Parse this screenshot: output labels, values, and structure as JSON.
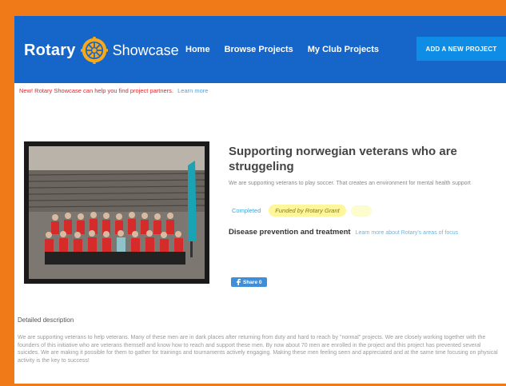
{
  "brand": {
    "name_left": "Rotary",
    "name_right": "Showcase"
  },
  "nav": {
    "home": "Home",
    "browse": "Browse Projects",
    "my_club": "My Club Projects"
  },
  "actions": {
    "add_project": "ADD A NEW PROJECT"
  },
  "notice": {
    "text": "New! Rotary Showcase can help you find project partners.",
    "link": "Learn more"
  },
  "project": {
    "title": "Supporting norwegian veterans who are struggeling",
    "summary": "We are supporting veterans to play soccer. That creates an environment for mental health support",
    "status": "Completed",
    "funding_badge": "Funded by Rotary Grant",
    "area_of_focus": "Disease prevention and treatment",
    "area_link": "Learn more about Rotary's areas of focus",
    "share_label": "Share 0"
  },
  "details": {
    "heading": "Detailed description",
    "body": "We are supporting veterans to help veterans. Many of these men are in dark places after returning from duty and hard to reach by \"normal\" projects. We are closely working together with the founders of this initiative who are veterans themself and know how to reach and support these men. By now about 70 men are enrolled in the project and this project has prevented several suicides. We are making it possible for them to gather for trainings and tournaments actively engaging. Making these men feeling seen and appreciated and at the same time focusing on physical activity is the key to success!"
  },
  "colors": {
    "header_bg": "#1665c9",
    "button_bg": "#0f8de6",
    "frame": "#f07a18",
    "badge_bg": "#fdf69a"
  },
  "icons": {
    "logo": "rotary-wheel-icon",
    "share": "facebook-icon"
  }
}
